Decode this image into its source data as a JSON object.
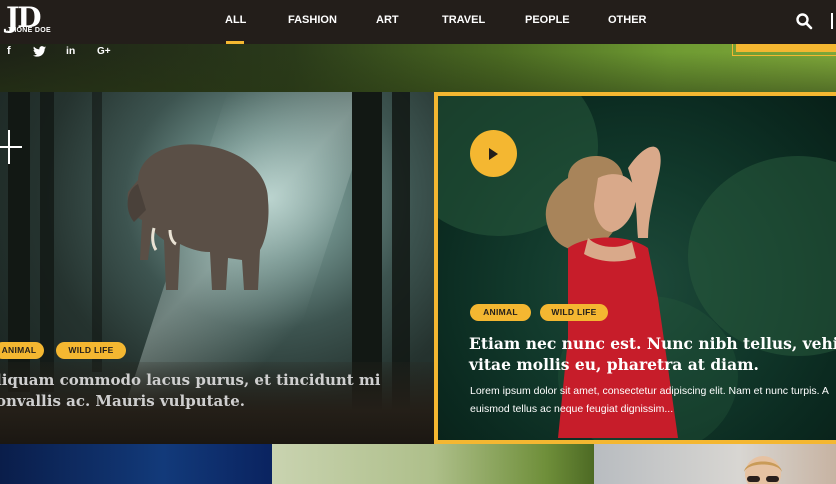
{
  "brand": {
    "logo_mark": "JD",
    "logo_text": "JHONE DOE"
  },
  "nav": {
    "items": [
      {
        "label": "ALL",
        "active": true
      },
      {
        "label": "FASHION",
        "active": false
      },
      {
        "label": "ART",
        "active": false
      },
      {
        "label": "TRAVEL",
        "active": false
      },
      {
        "label": "PEOPLE",
        "active": false
      },
      {
        "label": "OTHER",
        "active": false
      }
    ],
    "search_icon": "search-icon"
  },
  "social": [
    {
      "icon": "facebook-icon",
      "glyph": "f"
    },
    {
      "icon": "twitter-icon",
      "glyph": "t"
    },
    {
      "icon": "linkedin-icon",
      "glyph": "in"
    },
    {
      "icon": "google-plus-icon",
      "glyph": "G+"
    }
  ],
  "cards": {
    "left": {
      "tags": [
        "ANIMAL",
        "WILD LIFE"
      ],
      "title_lines": [
        "liquam commodo lacus purus, et tincidunt mi",
        "onvallis ac. Mauris vulputate."
      ]
    },
    "right": {
      "tags": [
        "ANIMAL",
        "WILD LIFE"
      ],
      "title_lines": [
        "Etiam nec nunc est. Nunc nibh tellus, vehicul",
        "vitae mollis eu, pharetra at diam."
      ],
      "excerpt_lines": [
        "Lorem ipsum dolor sit amet, consectetur adipiscing elit. Nam et nunc turpis. A",
        "euismod tellus ac neque feugiat dignissim..."
      ],
      "play_icon": "play-icon"
    }
  },
  "colors": {
    "accent": "#f4b731",
    "header_bg": "#231e1a",
    "text_light": "#ffffff"
  }
}
